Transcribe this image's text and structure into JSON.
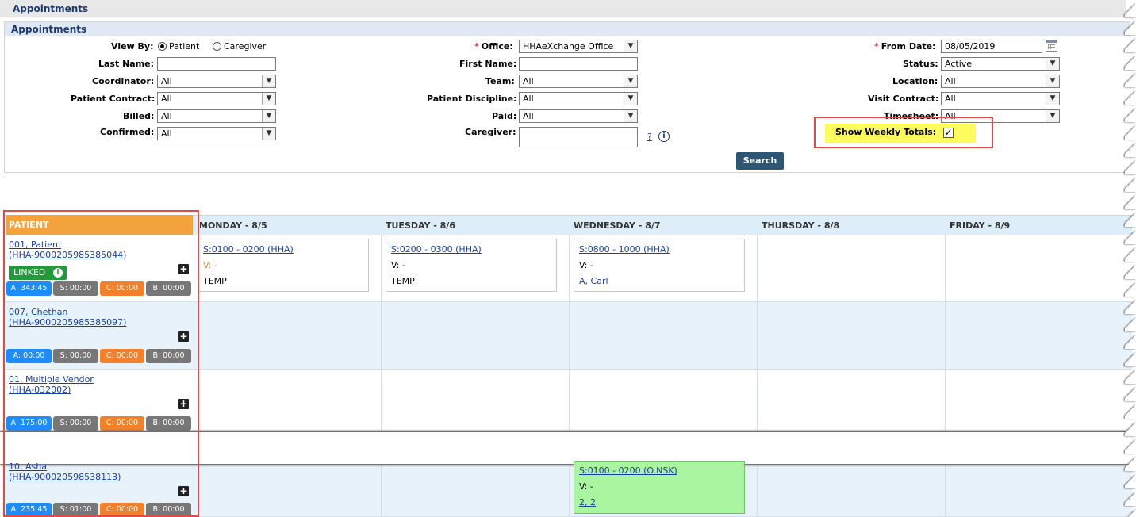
{
  "window": {
    "title": "Appointments"
  },
  "panel": {
    "title": "Appointments"
  },
  "filters": {
    "view_by": {
      "label": "View By:",
      "options": [
        "Patient",
        "Caregiver"
      ],
      "selected": "Patient"
    },
    "last_name": {
      "label": "Last Name:",
      "value": ""
    },
    "coordinator": {
      "label": "Coordinator:",
      "value": "All"
    },
    "patient_contract": {
      "label": "Patient Contract:",
      "value": "All"
    },
    "billed": {
      "label": "Billed:",
      "value": "All"
    },
    "confirmed": {
      "label": "Confirmed:",
      "value": "All"
    },
    "office": {
      "label": "Office:",
      "required": "*",
      "value": "HHAeXchange Office"
    },
    "first_name": {
      "label": "First Name:",
      "value": ""
    },
    "team": {
      "label": "Team:",
      "value": "All"
    },
    "patient_discipline": {
      "label": "Patient Discipline:",
      "value": "All"
    },
    "paid": {
      "label": "Paid:",
      "value": "All"
    },
    "caregiver": {
      "label": "Caregiver:",
      "value": "",
      "help": "?",
      "info": "i"
    },
    "from_date": {
      "label": "From Date:",
      "required": "*",
      "value": "08/05/2019"
    },
    "status": {
      "label": "Status:",
      "value": "Active"
    },
    "location": {
      "label": "Location:",
      "value": "All"
    },
    "visit_contract": {
      "label": "Visit Contract:",
      "value": "All"
    },
    "timesheet": {
      "label": "Timesheet:",
      "value": "All"
    },
    "show_weekly_totals": {
      "label": "Show Weekly Totals:",
      "checked": true,
      "mark": "✓"
    },
    "search_label": "Search"
  },
  "grid": {
    "patient_header": "PATIENT",
    "days": [
      "MONDAY - 8/5",
      "TUESDAY - 8/6",
      "WEDNESDAY - 8/7",
      "THURSDAY - 8/8",
      "FRIDAY - 8/9"
    ],
    "linked_label": "LINKED",
    "patients": [
      {
        "name": "001, Patient",
        "id": "(HHA-9000205985385044)",
        "a": "A: 343:45",
        "s": "S: 00:00",
        "c": "C: 00:00",
        "b": "B: 00:00"
      },
      {
        "name": "007, Chethan",
        "id": "(HHA-9000205985385097)",
        "a": "A: 00:00",
        "s": "S: 00:00",
        "c": "C: 00:00",
        "b": "B: 00:00"
      },
      {
        "name": "01, Multiple Vendor",
        "id": "(HHA-032002)",
        "a": "A: 175:00",
        "s": "S: 00:00",
        "c": "C: 00:00",
        "b": "B: 00:00"
      },
      {
        "name": "10, Asha",
        "id": "(HHA-900020598538113)",
        "a": "A: 235:45",
        "s": "S: 01:00",
        "c": "C: 00:00",
        "b": "B: 00:00"
      }
    ],
    "appointments": [
      {
        "s": "S:0100 - 0200 (HHA)",
        "v": "V: -",
        "t": "TEMP"
      },
      {
        "s": "S:0200 - 0300 (HHA)",
        "v": "V: -",
        "t": "TEMP"
      },
      {
        "s": "S:0800 - 1000 (HHA)",
        "v": "V: -",
        "t": "A, Carl"
      },
      {
        "s": "S:0100 - 0200 (O.NSK)",
        "v": "V: -",
        "t": "2, 2"
      }
    ]
  }
}
